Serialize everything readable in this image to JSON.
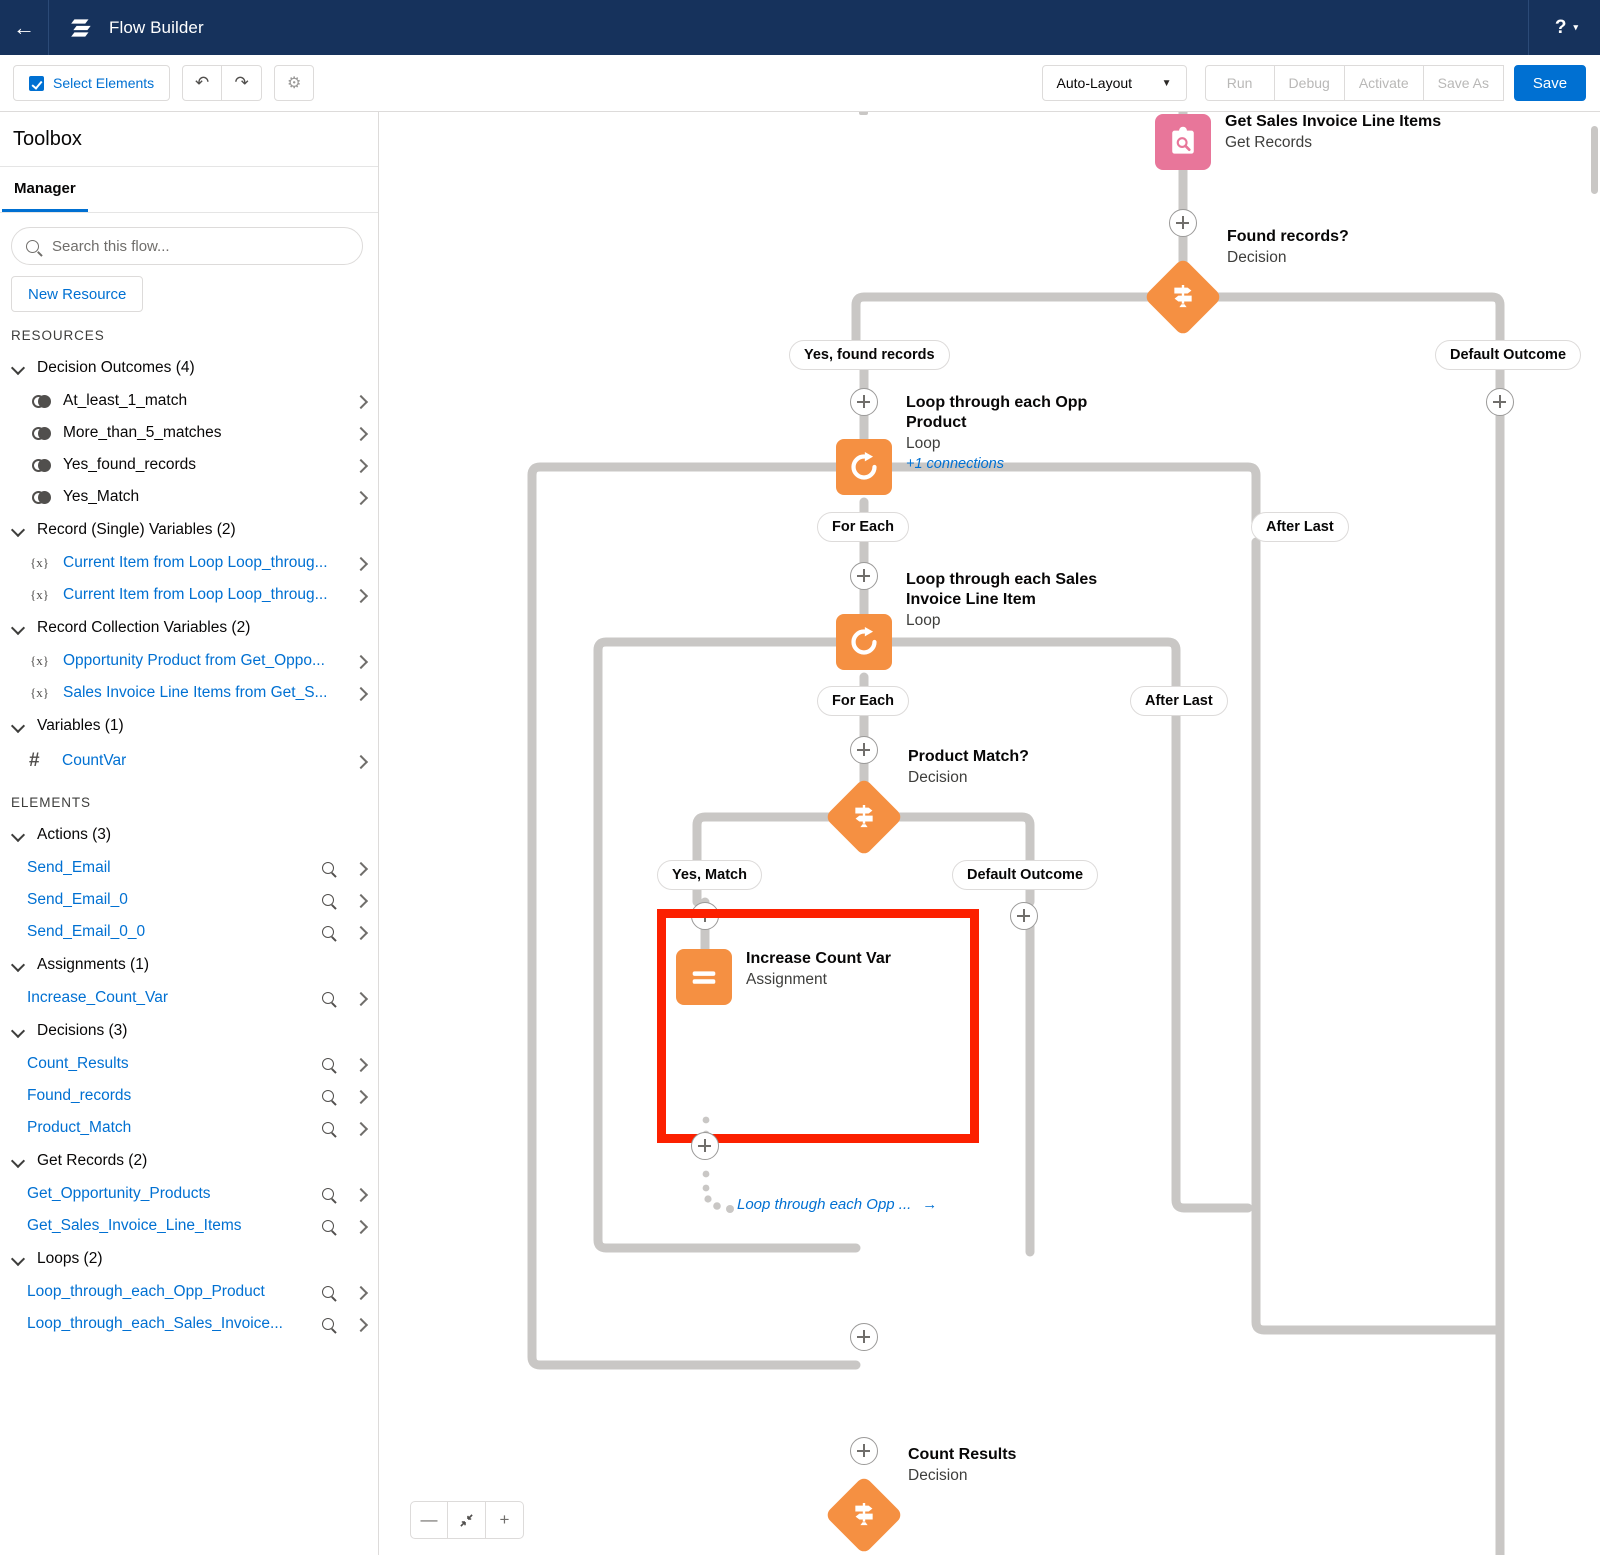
{
  "header": {
    "back_icon": "arrow-left-icon",
    "logo_icon": "flow-builder-logo-icon",
    "title": "Flow Builder",
    "help_label": "?",
    "help_caret": "▾"
  },
  "toolbar": {
    "select_elements_label": "Select Elements",
    "undo_icon": "↶",
    "redo_icon": "↷",
    "gear_icon": "⚙",
    "layout_value": "Auto-Layout",
    "layout_caret": "▼",
    "run_label": "Run",
    "debug_label": "Debug",
    "activate_label": "Activate",
    "save_as_label": "Save As",
    "save_label": "Save"
  },
  "sidebar": {
    "title": "Toolbox",
    "tab_label": "Manager",
    "search_placeholder": "Search this flow...",
    "search_value": "",
    "new_resource_label": "New Resource",
    "resources_label": "RESOURCES",
    "elements_label": "ELEMENTS",
    "resource_groups": [
      {
        "label": "Decision Outcomes (4)",
        "icon": "outcome-icon",
        "link": false,
        "items": [
          {
            "label": "At_least_1_match"
          },
          {
            "label": "More_than_5_matches"
          },
          {
            "label": "Yes_found_records"
          },
          {
            "label": "Yes_Match"
          }
        ]
      },
      {
        "label": "Record (Single) Variables (2)",
        "icon": "variable-icon",
        "link": true,
        "items": [
          {
            "label": "Current Item from Loop Loop_throug..."
          },
          {
            "label": "Current Item from Loop Loop_throug..."
          }
        ]
      },
      {
        "label": "Record Collection Variables (2)",
        "icon": "variable-icon",
        "link": true,
        "items": [
          {
            "label": "Opportunity Product from Get_Oppo..."
          },
          {
            "label": "Sales Invoice Line Items from Get_S..."
          }
        ]
      },
      {
        "label": "Variables (1)",
        "icon": "number-icon",
        "link": true,
        "items": [
          {
            "label": "CountVar"
          }
        ]
      }
    ],
    "element_groups": [
      {
        "label": "Actions (3)",
        "items": [
          {
            "label": "Send_Email"
          },
          {
            "label": "Send_Email_0"
          },
          {
            "label": "Send_Email_0_0"
          }
        ]
      },
      {
        "label": "Assignments (1)",
        "items": [
          {
            "label": "Increase_Count_Var"
          }
        ]
      },
      {
        "label": "Decisions (3)",
        "items": [
          {
            "label": "Count_Results"
          },
          {
            "label": "Found_records"
          },
          {
            "label": "Product_Match"
          }
        ]
      },
      {
        "label": "Get Records (2)",
        "items": [
          {
            "label": "Get_Opportunity_Products"
          },
          {
            "label": "Get_Sales_Invoice_Line_Items"
          }
        ]
      },
      {
        "label": "Loops (2)",
        "items": [
          {
            "label": "Loop_through_each_Opp_Product"
          },
          {
            "label": "Loop_through_each_Sales_Invoice..."
          }
        ]
      }
    ]
  },
  "canvas": {
    "nodes": [
      {
        "id": "get-sales-invoice-line-items",
        "name": "Get Sales Invoice Line Items",
        "type": "Get Records",
        "icon": "get-records-icon",
        "color": "#e8769a"
      },
      {
        "id": "found-records",
        "name": "Found records?",
        "type": "Decision",
        "icon": "decision-icon",
        "color": "#f59042"
      },
      {
        "id": "loop-through-each-opp-product",
        "name": "Loop through each Opp Product",
        "type": "Loop",
        "icon": "loop-icon",
        "color": "#f59042",
        "connections": "+1 connections"
      },
      {
        "id": "loop-through-each-sales-invoice-line-item",
        "name": "Loop through each Sales Invoice Line Item",
        "type": "Loop",
        "icon": "loop-icon",
        "color": "#f59042"
      },
      {
        "id": "product-match",
        "name": "Product Match?",
        "type": "Decision",
        "icon": "decision-icon",
        "color": "#f59042"
      },
      {
        "id": "increase-count-var",
        "name": "Increase Count Var",
        "type": "Assignment",
        "icon": "assignment-icon",
        "color": "#f59042"
      },
      {
        "id": "count-results",
        "name": "Count Results",
        "type": "Decision",
        "icon": "decision-icon",
        "color": "#f59042"
      }
    ],
    "branch_labels": {
      "yes_found_records": "Yes, found records",
      "default_outcome_top": "Default Outcome",
      "for_each_1": "For Each",
      "after_last_1": "After Last",
      "for_each_2": "For Each",
      "after_last_2": "After Last",
      "yes_match": "Yes, Match",
      "default_outcome_match": "Default Outcome"
    },
    "goto_label": "Loop through each Opp ...",
    "goto_arrow": "→",
    "highlight_color": "#fc2000",
    "zoom_controls": {
      "zoom_out": "—",
      "fit": "fit-icon",
      "zoom_in": "+"
    }
  }
}
